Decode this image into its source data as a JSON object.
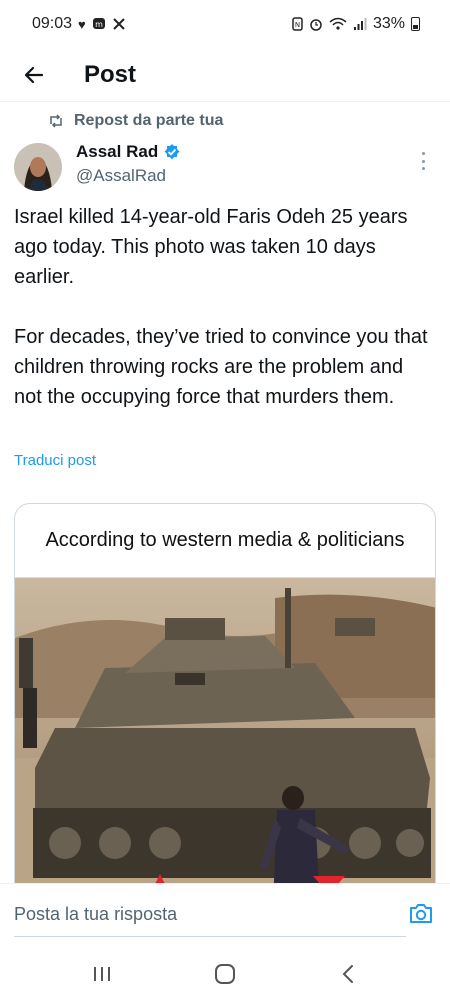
{
  "status_bar": {
    "time": "09:03",
    "battery": "33%",
    "icons_left": [
      "heart-icon",
      "mastodon-icon",
      "x-icon"
    ],
    "icons_right": [
      "nfc-icon",
      "alarm-icon",
      "wifi-icon",
      "signal-icon",
      "battery-icon"
    ]
  },
  "header": {
    "title": "Post"
  },
  "repost": {
    "label": "Repost da parte tua"
  },
  "author": {
    "name": "Assal Rad",
    "handle": "@AssalRad",
    "verified": true
  },
  "tweet": {
    "text": "Israel killed 14-year-old Faris Odeh 25 years ago today. This photo was taken 10 days earlier.\n\nFor decades, they’ve tried to convince you that children throwing rocks are the problem and not the occupying force that murders them.",
    "translate_label": "Traduci post"
  },
  "media": {
    "caption": "According to western media & politicians"
  },
  "reply": {
    "placeholder": "Posta la tua risposta"
  },
  "colors": {
    "link": "#1d9bf0",
    "secondary_text": "#536471",
    "verified": "#1d9bf0"
  }
}
